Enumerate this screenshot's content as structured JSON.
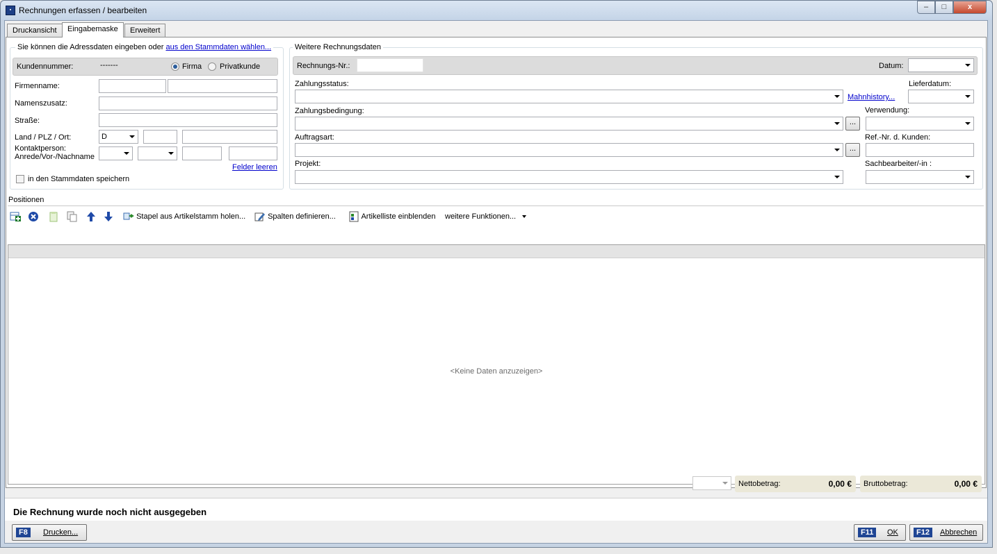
{
  "window": {
    "title": "Rechnungen erfassen / bearbeiten",
    "app_icon": "invoice-app-icon",
    "controls": {
      "minimize": "–",
      "maximize": "□",
      "close": "x"
    }
  },
  "tabs": [
    {
      "label": "Druckansicht",
      "active": false
    },
    {
      "label": "Eingabemaske",
      "active": true
    },
    {
      "label": "Erweitert",
      "active": false
    }
  ],
  "address": {
    "intro_text": "Sie können die Adressdaten eingeben oder",
    "intro_link": "aus den Stammdaten wählen...",
    "customer_number_label": "Kundennummer:",
    "customer_number_value": "-------",
    "radio_firma": "Firma",
    "radio_privat": "Privatkunde",
    "selected_type": "Firma",
    "company_name_label": "Firmenname:",
    "name_addition_label": "Namenszusatz:",
    "street_label": "Straße:",
    "country_zip_city_label": "Land / PLZ / Ort:",
    "country_value": "D",
    "contact_label_line1": "Kontaktperson:",
    "contact_label_line2": "Anrede/Vor-/Nachname",
    "clear_fields_link": "Felder leeren",
    "save_master_data_label": "in den Stammdaten speichern",
    "save_master_data_checked": false
  },
  "invoice": {
    "section_title": "Weitere Rechnungsdaten",
    "invoice_number_label": "Rechnungs-Nr.:",
    "invoice_number_value": "",
    "date_label": "Datum:",
    "payment_status_label": "Zahlungsstatus:",
    "dunning_history_link": "Mahnhistory...",
    "delivery_date_label": "Lieferdatum:",
    "payment_terms_label": "Zahlungsbedingung:",
    "usage_label": "Verwendung:",
    "order_type_label": "Auftragsart:",
    "customer_ref_label": "Ref.-Nr. d. Kunden:",
    "project_label": "Projekt:",
    "clerk_label": "Sachbearbeiter/-in :",
    "ellipsis_button": "..."
  },
  "positions": {
    "section_title": "Positionen",
    "toolbar": {
      "add_icon": "add-row-icon",
      "delete_icon": "delete-circle-icon",
      "copy_icon": "copy-icon",
      "paste_icon": "paste-icon",
      "up_icon": "arrow-up-icon",
      "down_icon": "arrow-down-icon",
      "batch_label": "Stapel aus Artikelstamm holen...",
      "columns_label": "Spalten definieren...",
      "article_list_label": "Artikelliste einblenden",
      "more_label": "weitere Funktionen..."
    },
    "empty_text": "<Keine Daten anzuzeigen>"
  },
  "totals": {
    "net_label": "Nettobetrag:",
    "net_value": "0,00 €",
    "gross_label": "Bruttobetrag:",
    "gross_value": "0,00 €"
  },
  "status_message": "Die Rechnung wurde noch nicht ausgegeben",
  "footer": {
    "print_key": "F8",
    "print_label": "Drucken...",
    "ok_key": "F11",
    "ok_label": "OK",
    "cancel_key": "F12",
    "cancel_label": "Abbrechen"
  }
}
